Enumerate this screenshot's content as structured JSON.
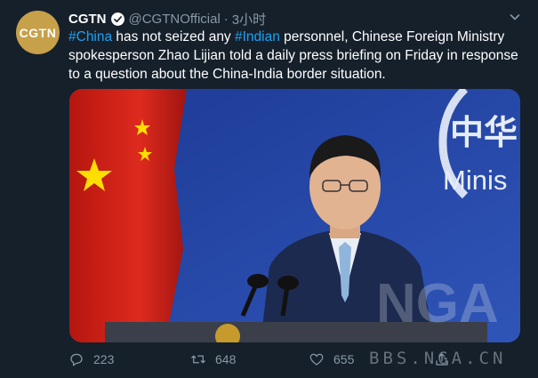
{
  "avatar": {
    "text": "CGTN"
  },
  "author": {
    "display_name": "CGTN",
    "handle": "@CGTNOfficial",
    "separator": "·",
    "time": "3小时"
  },
  "tweet": {
    "hashtag_1": "#China",
    "text_1": " has not seized any ",
    "hashtag_2": "#Indian",
    "text_2": " personnel, Chinese Foreign Ministry spokesperson Zhao Lijian told a daily press briefing on Friday in response to a question about the China-India border situation."
  },
  "media": {
    "backdrop_text_cn": "中华",
    "backdrop_text_en": "Minis",
    "photo_watermark": "NGA"
  },
  "actions": {
    "reply_count": "223",
    "retweet_count": "648",
    "like_count": "655"
  },
  "watermark": "BBS.NGA.CN",
  "colors": {
    "background": "#15202b",
    "hashtag": "#1da1f2",
    "secondary_text": "#8899a6",
    "flag_red": "#d8261c",
    "backdrop_blue": "#2c4aa8"
  }
}
